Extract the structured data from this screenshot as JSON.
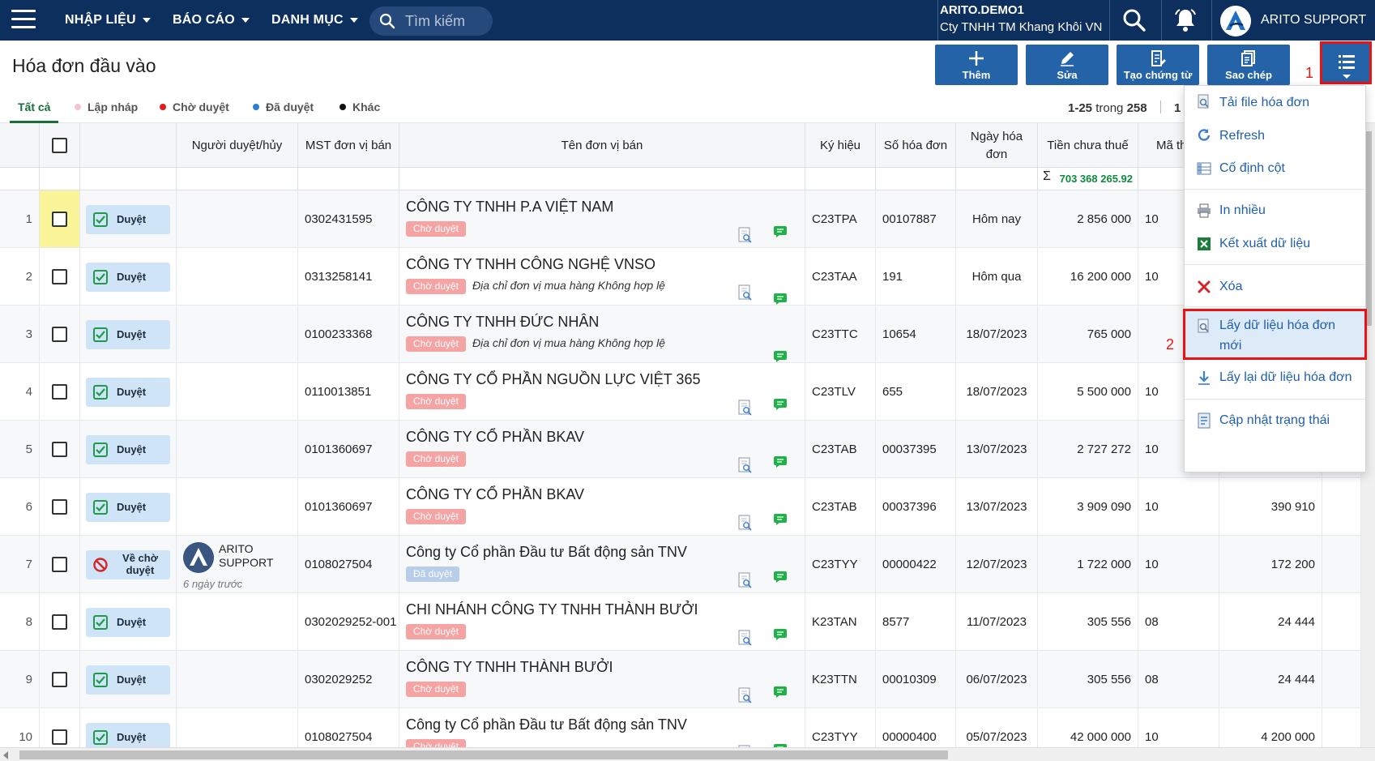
{
  "topbar": {
    "menus": [
      "NHẬP LIỆU",
      "BÁO CÁO",
      "DANH MỤC"
    ],
    "search_placeholder": "Tìm kiếm",
    "company_code": "ARITO.DEMO1",
    "company_name": "Cty TNHH TM Khang Khôi VN",
    "user_name": "ARITO SUPPORT"
  },
  "page": {
    "title": "Hóa đơn đầu vào",
    "toolbar": {
      "add": "Thêm",
      "edit": "Sửa",
      "create_voucher": "Tạo chứng từ",
      "copy": "Sao chép",
      "marker_1": "1"
    }
  },
  "tabs": [
    {
      "label": "Tất cả",
      "color": ""
    },
    {
      "label": "Lập nháp",
      "color": "#f3c6d2"
    },
    {
      "label": "Chờ duyệt",
      "color": "#e31b1b"
    },
    {
      "label": "Đã duyệt",
      "color": "#2a7fd4"
    },
    {
      "label": "Khác",
      "color": "#111111"
    }
  ],
  "pager": {
    "range": "1-25",
    "word": "trong",
    "total": "258",
    "extra": "1"
  },
  "table": {
    "headers": {
      "approver": "Người duyệt/hủy",
      "tax_code": "MST đơn vị bán",
      "seller": "Tên đơn vị bán",
      "symbol": "Ký hiệu",
      "invoice_no": "Số hóa đơn",
      "date": "Ngày hóa đơn",
      "amount": "Tiền chưa thuế",
      "tax_rate": "Mã th"
    },
    "sum_symbol": "Σ",
    "sum_amount": "703 368 265.92",
    "rows": [
      {
        "n": "1",
        "action": "Duyệt",
        "approver": "",
        "approver_time": "",
        "tax": "0302431595",
        "seller": "CÔNG TY TNHH P.A VIỆT NAM",
        "status": "Chờ duyệt",
        "warn": "",
        "symbol": "C23TPA",
        "no": "00107887",
        "date": "Hôm nay",
        "amount": "2 856 000",
        "rate": "10",
        "vat": ""
      },
      {
        "n": "2",
        "action": "Duyệt",
        "approver": "",
        "approver_time": "",
        "tax": "0313258141",
        "seller": "CÔNG TY TNHH CÔNG NGHỆ VNSO",
        "status": "Chờ duyệt",
        "warn": "Địa chỉ đơn vị mua hàng Không hợp lệ",
        "symbol": "C23TAA",
        "no": "191",
        "date": "Hôm qua",
        "amount": "16 200 000",
        "rate": "10",
        "vat": ""
      },
      {
        "n": "3",
        "action": "Duyệt",
        "approver": "",
        "approver_time": "",
        "tax": "0100233368",
        "seller": "CÔNG TY TNHH ĐỨC NHÂN",
        "status": "Chờ duyệt",
        "warn": "Địa chỉ đơn vị mua hàng Không hợp lệ",
        "symbol": "C23TTC",
        "no": "10654",
        "date": "18/07/2023",
        "amount": "765 000",
        "rate": "",
        "vat": ""
      },
      {
        "n": "4",
        "action": "Duyệt",
        "approver": "",
        "approver_time": "",
        "tax": "0110013851",
        "seller": "CÔNG TY CỔ PHẦN NGUỒN LỰC VIỆT 365",
        "status": "Chờ duyệt",
        "warn": "",
        "symbol": "C23TLV",
        "no": "655",
        "date": "18/07/2023",
        "amount": "5 500 000",
        "rate": "10",
        "vat": ""
      },
      {
        "n": "5",
        "action": "Duyệt",
        "approver": "",
        "approver_time": "",
        "tax": "0101360697",
        "seller": "CÔNG TY CỔ PHẦN BKAV",
        "status": "Chờ duyệt",
        "warn": "",
        "symbol": "C23TAB",
        "no": "00037395",
        "date": "13/07/2023",
        "amount": "2 727 272",
        "rate": "10",
        "vat": ""
      },
      {
        "n": "6",
        "action": "Duyệt",
        "approver": "",
        "approver_time": "",
        "tax": "0101360697",
        "seller": "CÔNG TY CỔ PHẦN BKAV",
        "status": "Chờ duyệt",
        "warn": "",
        "symbol": "C23TAB",
        "no": "00037396",
        "date": "13/07/2023",
        "amount": "3 909 090",
        "rate": "10",
        "vat": "390 910"
      },
      {
        "n": "7",
        "action": "Về chờ duyệt",
        "approver": "ARITO SUPPORT",
        "approver_time": "6 ngày trước",
        "tax": "0108027504",
        "seller": "Công ty Cổ phần Đầu tư Bất động sản TNV",
        "status": "Đã duyệt",
        "warn": "",
        "symbol": "C23TYY",
        "no": "00000422",
        "date": "12/07/2023",
        "amount": "1 722 000",
        "rate": "10",
        "vat": "172 200"
      },
      {
        "n": "8",
        "action": "Duyệt",
        "approver": "",
        "approver_time": "",
        "tax": "0302029252-001",
        "seller": "CHI NHÁNH CÔNG TY TNHH THÀNH BƯỞI",
        "status": "Chờ duyệt",
        "warn": "",
        "symbol": "K23TAN",
        "no": "8577",
        "date": "11/07/2023",
        "amount": "305 556",
        "rate": "08",
        "vat": "24 444"
      },
      {
        "n": "9",
        "action": "Duyệt",
        "approver": "",
        "approver_time": "",
        "tax": "0302029252",
        "seller": "CÔNG TY TNHH THÀNH BƯỞI",
        "status": "Chờ duyệt",
        "warn": "",
        "symbol": "K23TTN",
        "no": "00010309",
        "date": "06/07/2023",
        "amount": "305 556",
        "rate": "08",
        "vat": "24 444"
      },
      {
        "n": "10",
        "action": "Duyệt",
        "approver": "",
        "approver_time": "",
        "tax": "0108027504",
        "seller": "Công ty Cổ phần Đầu tư Bất động sản TNV",
        "status": "Chờ duyệt",
        "warn": "",
        "symbol": "C23TYY",
        "no": "00000400",
        "date": "05/07/2023",
        "amount": "42 000 000",
        "rate": "10",
        "vat": "4 200 000"
      }
    ]
  },
  "dropdown": {
    "items": [
      {
        "label": "Tải file hóa đơn",
        "icon": "file-search-icon"
      },
      {
        "label": "Refresh",
        "icon": "refresh-icon"
      },
      {
        "label": "Cố định cột",
        "icon": "pin-columns-icon"
      },
      {
        "label": "In nhiều",
        "icon": "printer-icon"
      },
      {
        "label": "Kết xuất dữ liệu",
        "icon": "excel-export-icon"
      },
      {
        "label": "Xóa",
        "icon": "delete-icon"
      },
      {
        "label": "Lấy dữ liệu hóa đơn mới",
        "icon": "fetch-invoice-icon"
      },
      {
        "label": "Lấy lại dữ liệu hóa đơn",
        "icon": "download-arrow-icon"
      },
      {
        "label": "Cập nhật trạng thái",
        "icon": "update-status-icon"
      }
    ],
    "marker_2": "2"
  }
}
